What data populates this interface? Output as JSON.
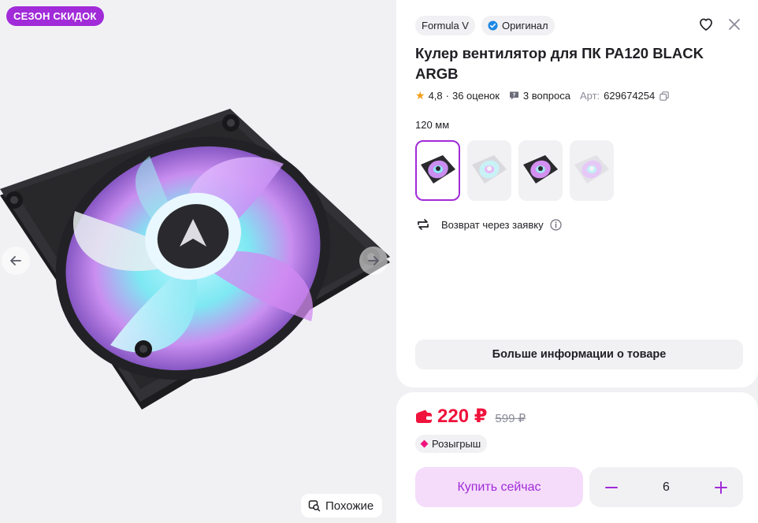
{
  "gallery": {
    "promo_badge": "СЕЗОН СКИДОК",
    "similar_label": "Похожие"
  },
  "seller": {
    "brand": "Formula V",
    "original_label": "Оригинал"
  },
  "product": {
    "title": "Кулер вентилятор для ПК PA120 BLACK ARGB",
    "rating": "4,8",
    "reviews": "36 оценок",
    "questions": "3 вопроса",
    "article_label": "Арт:",
    "article_value": "629674254",
    "variant_label": "120 мм",
    "return_text": "Возврат через заявку",
    "more_info_label": "Больше информации о товаре"
  },
  "variants": [
    {
      "style": "black",
      "selected": true
    },
    {
      "style": "white",
      "selected": false
    },
    {
      "style": "black",
      "selected": false
    },
    {
      "style": "white",
      "selected": false
    }
  ],
  "price": {
    "current": "220 ₽",
    "old": "599 ₽",
    "lottery_label": "Розыгрыш",
    "buy_label": "Купить сейчас",
    "quantity": "6"
  },
  "colors": {
    "accent": "#a12bd8",
    "price": "#f0133c",
    "star": "#f29e1a",
    "verified": "#1e88e5"
  }
}
